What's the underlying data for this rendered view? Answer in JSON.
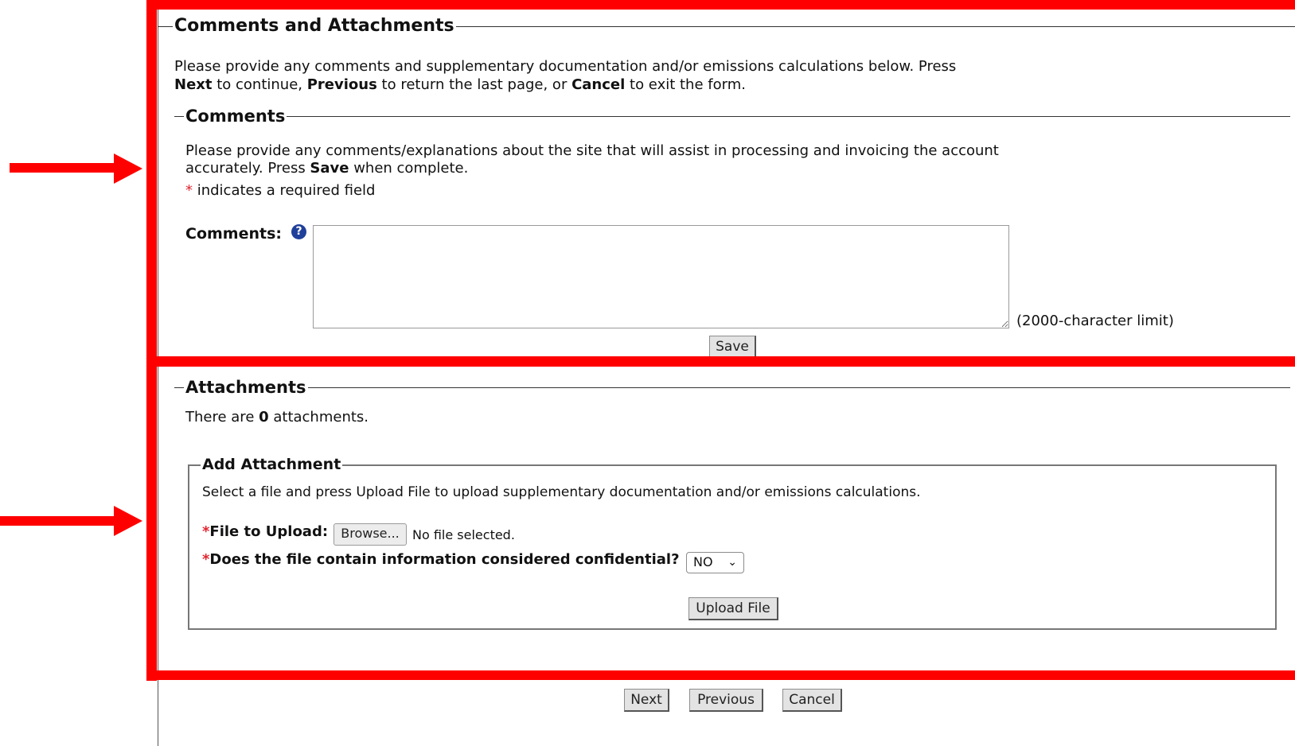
{
  "main": {
    "section_title": "Comments and Attachments",
    "intro": {
      "part1": "Please provide any comments and supplementary documentation and/or emissions calculations below. Press",
      "next_word": "Next",
      "part2": " to continue, ",
      "previous_word": "Previous",
      "part3": " to return the last page, or ",
      "cancel_word": "Cancel",
      "part4": " to exit the form."
    }
  },
  "comments": {
    "legend": "Comments",
    "instructions_line1": "Please provide any comments/explanations about the site that will assist in processing and invoicing the account",
    "instructions_line2_pre": "accurately. Press ",
    "save_word": "Save",
    "instructions_line2_post": " when complete.",
    "required_star": "*",
    "required_note": " indicates a required field",
    "field_label": "Comments:",
    "help_icon_glyph": "?",
    "textarea_value": "",
    "char_limit": "(2000-character limit)",
    "save_button": "Save"
  },
  "attachments": {
    "legend": "Attachments",
    "count_pre": "There are ",
    "count": "0",
    "count_post": " attachments.",
    "add": {
      "legend": "Add Attachment",
      "instructions": "Select a file and press Upload File to upload supplementary documentation and/or emissions calculations.",
      "required_star": "*",
      "file_label": "File to Upload:",
      "browse_button": "Browse...",
      "file_status": "No file selected.",
      "confidential_label": "Does the file contain information considered confidential?",
      "confidential_value": "NO",
      "dropdown_icon": "chevron-down",
      "upload_button": "Upload File"
    }
  },
  "nav": {
    "next_button": "Next",
    "previous_button": "Previous",
    "cancel_button": "Cancel"
  },
  "colors": {
    "annotation_red": "#ff0000",
    "required_star": "#e0262f",
    "help_icon": "#1f3f9a"
  }
}
